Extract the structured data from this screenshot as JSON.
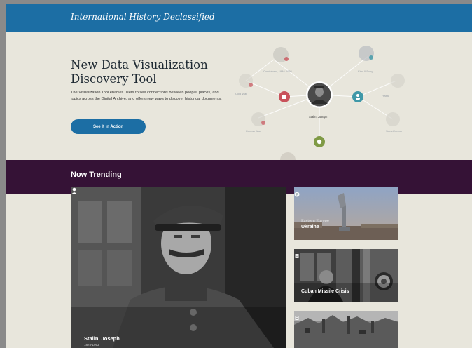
{
  "header": {
    "brand": "International History Declassified"
  },
  "hero": {
    "title_line1": "New Data Visualization",
    "title_line2": "Discovery Tool",
    "description": "The Visualization Tool enables users to see connections between people, places, and topics across the Digital Archive, and offers new ways to discover historical documents.",
    "button_label": "See It In Action",
    "viz": {
      "center_label": "Stalin, Joseph",
      "node_labels": [
        "Cominform, 1946-1956",
        "Kim, Il Sung",
        "Cold War",
        "Korean War",
        "Yalta",
        "Soviet Union"
      ]
    }
  },
  "trending": {
    "title": "Now Trending",
    "main_card": {
      "name": "Stalin, Joseph",
      "years": "1878-1953",
      "icon": "user-icon"
    },
    "side_cards": [
      {
        "category": "Eastern Europe",
        "title": "Ukraine",
        "icon": "globe-icon"
      },
      {
        "category": "",
        "title": "Cuban Missile Crisis",
        "icon": "document-icon"
      },
      {
        "category": "",
        "title": "",
        "icon": "document-icon"
      }
    ]
  },
  "colors": {
    "header_blue": "#1c6ea4",
    "trending_purple": "#351236",
    "page_bg": "#e8e6dc",
    "node_red": "#c9525b",
    "node_teal": "#3f98a8",
    "node_green": "#7f9a45"
  }
}
